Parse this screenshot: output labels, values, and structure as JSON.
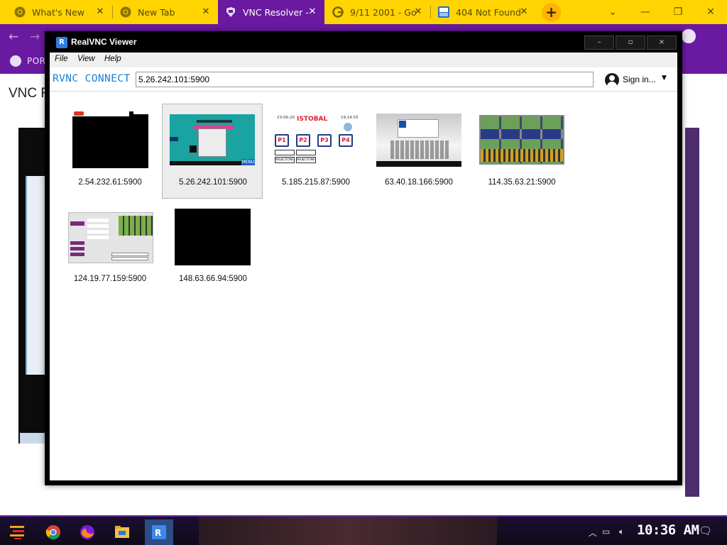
{
  "browser": {
    "tabs": [
      {
        "title": "What's New",
        "icon": "chrome-icon",
        "active": false
      },
      {
        "title": "New Tab",
        "icon": "chrome-icon",
        "active": false
      },
      {
        "title": "VNC Resolver -",
        "icon": "vnc-resolver-icon",
        "active": true
      },
      {
        "title": "9/11 2001 - Go",
        "icon": "google-icon",
        "active": false
      },
      {
        "title": "404 Not Found",
        "icon": "bitview-icon",
        "active": false
      }
    ],
    "new_tab_label": "+",
    "bookmark_label": "POR",
    "page_heading": "VNC R",
    "window_controls": {
      "minimize": "⌄",
      "restore": "❐",
      "close": "✕"
    }
  },
  "vnc_window": {
    "title": "RealVNC Viewer",
    "controls": {
      "minimize": "–",
      "maximize": "▫",
      "close": "×"
    },
    "menu": [
      "File",
      "View",
      "Help"
    ],
    "brand": "RVNC CONNECT",
    "address_value": "5.26.242.101:5900",
    "sign_in_label": "Sign in...",
    "connections": [
      {
        "address": "2.54.232.61:5900",
        "selected": false
      },
      {
        "address": "5.26.242.101:5900",
        "selected": true
      },
      {
        "address": "5.185.215.87:5900",
        "selected": false
      },
      {
        "address": "63.40.18.166:5900",
        "selected": false
      },
      {
        "address": "114.35.63.21:5900",
        "selected": false
      },
      {
        "address": "124.19.77.159:5900",
        "selected": false
      },
      {
        "address": "148.63.66.94:5900",
        "selected": false
      }
    ],
    "thumb_text": {
      "menu": "MENU",
      "brand": "ISTOBAL",
      "date": "23-06-20",
      "time": "19:14:55",
      "p1": "P1",
      "p2": "P2",
      "p3": "P3",
      "p4": "P4",
      "status": "WŁĄCZONE"
    }
  },
  "taskbar": {
    "clock": "10:36 AM",
    "apps": [
      "start-icon",
      "chrome-icon",
      "firefox-icon",
      "file-explorer-icon",
      "realvnc-icon"
    ]
  },
  "colors": {
    "tab_strip": "#ffd400",
    "active_tab": "#6a1aa0",
    "vnc_brand": "#1480d8"
  }
}
